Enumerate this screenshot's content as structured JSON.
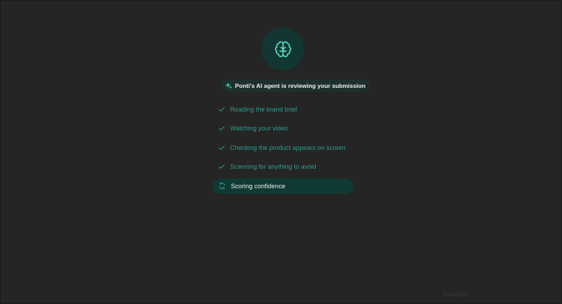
{
  "header": {
    "icon": "brain-icon",
    "status_text": "Ponti's AI agent is reviewing your submission",
    "status_icon": "sparkle-icon"
  },
  "steps": [
    {
      "label": "Reading the brand brief",
      "state": "done",
      "icon": "check-icon"
    },
    {
      "label": "Watching your video",
      "state": "done",
      "icon": "check-icon"
    },
    {
      "label": "Checking the product appears on screen",
      "state": "done",
      "icon": "check-icon"
    },
    {
      "label": "Scanning for anything to avoid",
      "state": "done",
      "icon": "check-icon"
    },
    {
      "label": "Scoring confidence",
      "state": "in-progress",
      "icon": "spinner-icon"
    }
  ],
  "watermark": "Flameshot",
  "colors": {
    "background": "#252525",
    "accent": "#2f9c8c",
    "icon_accent": "#4fe0c8",
    "active_row": "#0f3a33"
  }
}
